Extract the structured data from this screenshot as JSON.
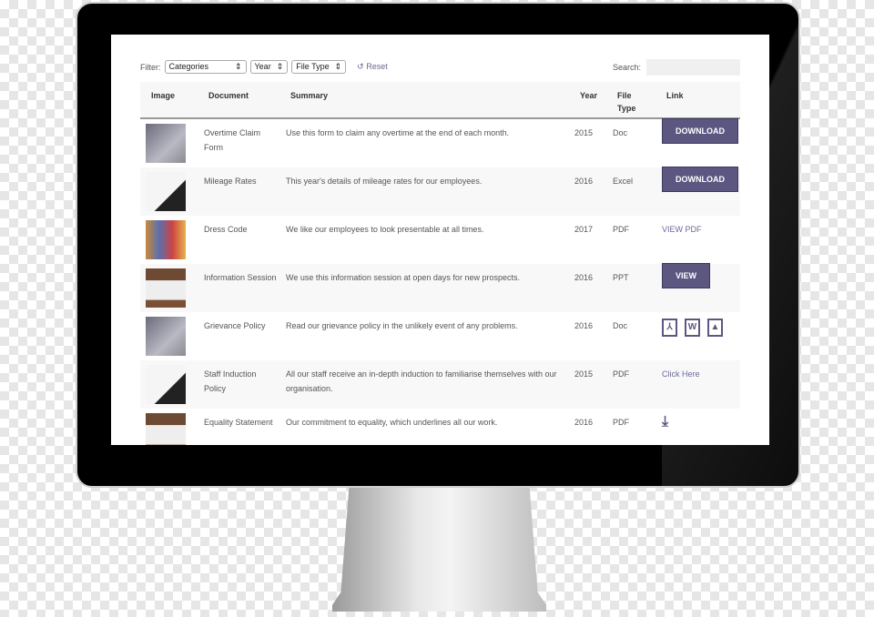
{
  "filter": {
    "label": "Filter:",
    "categories": "Categories",
    "year": "Year",
    "file_type": "File Type",
    "reset": "Reset"
  },
  "search": {
    "label": "Search:",
    "value": ""
  },
  "headers": [
    "Image",
    "Document",
    "Summary",
    "Year",
    "File Type",
    "Link"
  ],
  "rows": [
    {
      "document": "Overtime Claim Form",
      "summary": "Use this form to claim any overtime at the end of each month.",
      "year": "2015",
      "type": "Doc",
      "link": "DOWNLOAD"
    },
    {
      "document": "Mileage Rates",
      "summary": "This year's details of mileage rates for our employees.",
      "year": "2016",
      "type": "Excel",
      "link": "DOWNLOAD"
    },
    {
      "document": "Dress Code",
      "summary": "We like our employees to look presentable at all times.",
      "year": "2017",
      "type": "PDF",
      "link": "VIEW PDF"
    },
    {
      "document": "Information Session",
      "summary": "We use this information session at open days for new prospects.",
      "year": "2016",
      "type": "PPT",
      "link": "VIEW"
    },
    {
      "document": "Grievance Policy",
      "summary": "Read our grievance policy in the unlikely event of any problems.",
      "year": "2016",
      "type": "Doc",
      "link": "pdf-icon, word-icon, image-icon"
    },
    {
      "document": "Staff Induction Policy",
      "summary": "All our staff receive an in-depth induction to familiarise themselves with our organisation.",
      "year": "2015",
      "type": "PDF",
      "link": "Click Here"
    },
    {
      "document": "Equality Statement",
      "summary": "Our commitment to equality, which underlines all our work.",
      "year": "2016",
      "type": "PDF",
      "link": "download-icon"
    }
  ],
  "colors": {
    "accent": "#5c5780"
  }
}
